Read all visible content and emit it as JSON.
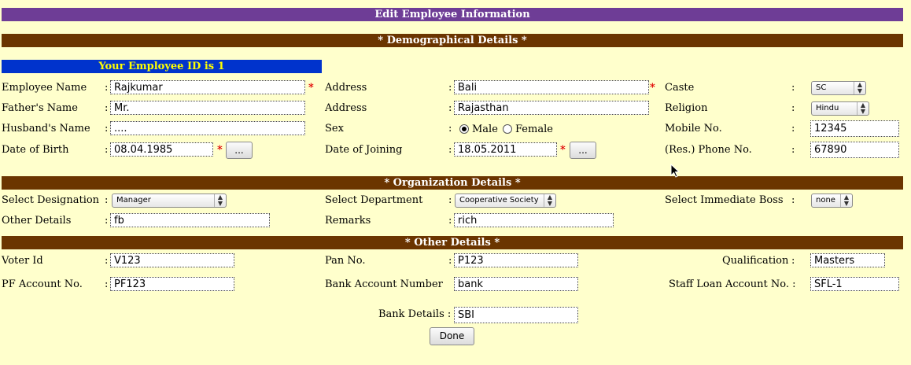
{
  "header": {
    "title": "Edit Employee Information",
    "demographic": "* Demographical Details *",
    "organization": "* Organization Details *",
    "other": "* Other Details *",
    "employee_id_text": "Your Employee ID is 1"
  },
  "demo": {
    "employee_name": {
      "label": "Employee Name",
      "value": "Rajkumar"
    },
    "fathers_name": {
      "label": "Father's Name",
      "value": "Mr."
    },
    "husbands_name": {
      "label": "Husband's Name",
      "value": "...."
    },
    "dob": {
      "label": "Date of Birth",
      "value": "08.04.1985"
    },
    "address1": {
      "label": "Address",
      "value": "Bali"
    },
    "address2": {
      "label": "Address",
      "value": "Rajasthan"
    },
    "sex": {
      "label": "Sex",
      "male": "Male",
      "female": "Female",
      "selected": "Male"
    },
    "doj": {
      "label": "Date of Joining",
      "value": "18.05.2011"
    },
    "caste": {
      "label": "Caste",
      "value": "SC"
    },
    "religion": {
      "label": "Religion",
      "value": "Hindu"
    },
    "mobile": {
      "label": "Mobile No.",
      "value": "12345"
    },
    "res_phone": {
      "label": "(Res.) Phone No.",
      "value": "67890"
    },
    "calendar_button": "...",
    "colon": ":",
    "required_mark": "*"
  },
  "org": {
    "designation": {
      "label": "Select Designation",
      "value": "Manager"
    },
    "department": {
      "label": "Select Department",
      "value": "Cooperative Society"
    },
    "boss": {
      "label": "Select Immediate Boss",
      "value": "none"
    },
    "other_details": {
      "label": "Other Details",
      "value": "fb"
    },
    "remarks": {
      "label": "Remarks",
      "value": "rich"
    }
  },
  "other": {
    "voter_id": {
      "label": "Voter Id",
      "value": "V123"
    },
    "pan": {
      "label": "Pan No.",
      "value": "P123"
    },
    "qualification": {
      "label": "Qualification",
      "value": "Masters"
    },
    "pf_account": {
      "label": "PF Account No.",
      "value": "PF123"
    },
    "bank_account": {
      "label": "Bank Account Number",
      "value": "bank"
    },
    "staff_loan": {
      "label": "Staff Loan Account No. :",
      "value": "SFL-1"
    },
    "bank_details": {
      "label": "Bank Details :",
      "value": "SBI"
    }
  },
  "actions": {
    "done": "Done"
  }
}
